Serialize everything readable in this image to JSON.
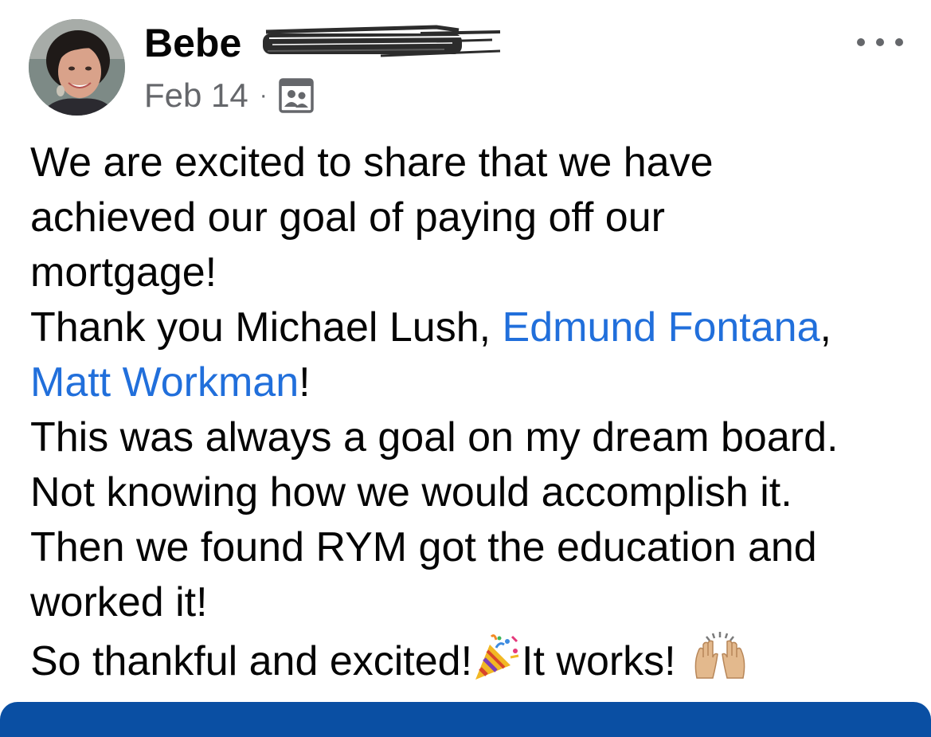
{
  "post": {
    "author": {
      "first_name": "Bebe",
      "avatar_icon": "profile-photo",
      "last_name_redacted": true
    },
    "meta": {
      "date": "Feb 14",
      "separator": "·",
      "audience_icon": "group-audience-icon"
    },
    "more_icon": "more-options-icon",
    "body": {
      "line1": "We are excited to share that we have",
      "line2": "achieved our goal of paying off our",
      "line3": "mortgage!",
      "line4_prefix": "Thank you Michael Lush, ",
      "mention1": "Edmund Fontana",
      "line4_suffix": ",",
      "mention2": "Matt Workman",
      "line5_suffix": "!",
      "line6": "This was always a goal on my dream board.",
      "line7": "Not knowing how we would accomplish it.",
      "line8": "Then we found RYM got the education and",
      "line9": "worked it!",
      "line10_part1": "So thankful and excited!",
      "emoji1": "party-popper-icon",
      "line10_part2": "It works!",
      "emoji2": "raising-hands-icon"
    }
  },
  "colors": {
    "text": "#050505",
    "secondary_text": "#65676b",
    "mention": "#216fdb",
    "bottom_bar": "#0a4fa3"
  }
}
